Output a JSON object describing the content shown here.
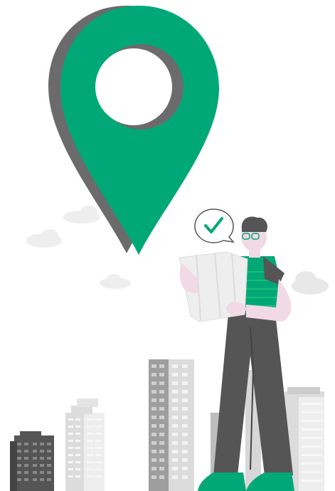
{
  "colors": {
    "accent": "#00a878",
    "pin_shadow": "#6b6b6b",
    "dark_gray": "#555555",
    "mid_gray": "#9e9e9e",
    "light_gray": "#dcdcdc",
    "skin": "#f2d9e6",
    "background": "#ffffff"
  },
  "icons": {
    "pin": "location-pin-icon",
    "check": "checkmark-icon",
    "bubble": "speech-bubble-icon"
  }
}
